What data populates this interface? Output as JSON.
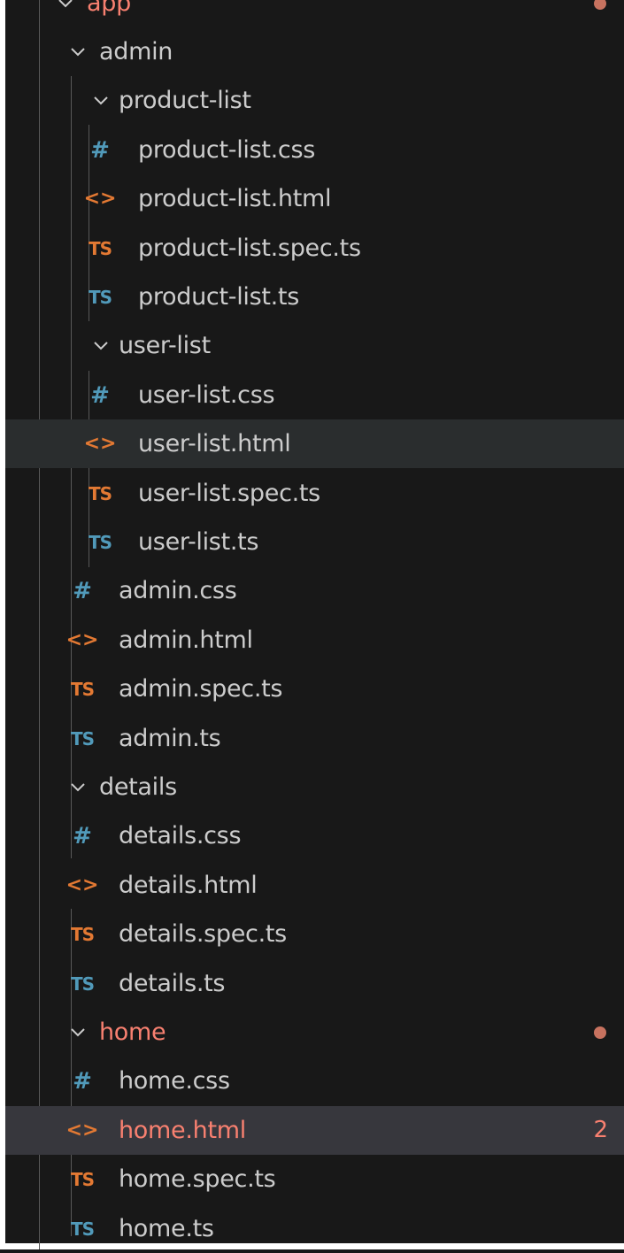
{
  "explorer": {
    "root": {
      "label": "app",
      "modified": true
    },
    "items": [
      {
        "kind": "folder",
        "label": "admin",
        "depth": 1
      },
      {
        "kind": "folder",
        "label": "product-list",
        "depth": 2
      },
      {
        "kind": "css",
        "label": "product-list.css",
        "depth": 3
      },
      {
        "kind": "html",
        "label": "product-list.html",
        "depth": 3
      },
      {
        "kind": "ts-spec",
        "label": "product-list.spec.ts",
        "depth": 3
      },
      {
        "kind": "ts",
        "label": "product-list.ts",
        "depth": 3
      },
      {
        "kind": "folder",
        "label": "user-list",
        "depth": 2
      },
      {
        "kind": "css",
        "label": "user-list.css",
        "depth": 3
      },
      {
        "kind": "html",
        "label": "user-list.html",
        "depth": 3,
        "state": "hover"
      },
      {
        "kind": "ts-spec",
        "label": "user-list.spec.ts",
        "depth": 3
      },
      {
        "kind": "ts",
        "label": "user-list.ts",
        "depth": 3
      },
      {
        "kind": "css",
        "label": "admin.css",
        "depth": 2
      },
      {
        "kind": "html",
        "label": "admin.html",
        "depth": 2
      },
      {
        "kind": "ts-spec",
        "label": "admin.spec.ts",
        "depth": 2
      },
      {
        "kind": "ts",
        "label": "admin.ts",
        "depth": 2
      },
      {
        "kind": "folder",
        "label": "details",
        "depth": 1
      },
      {
        "kind": "css",
        "label": "details.css",
        "depth": 2
      },
      {
        "kind": "html",
        "label": "details.html",
        "depth": 2
      },
      {
        "kind": "ts-spec",
        "label": "details.spec.ts",
        "depth": 2
      },
      {
        "kind": "ts",
        "label": "details.ts",
        "depth": 2
      },
      {
        "kind": "folder",
        "label": "home",
        "depth": 1,
        "modified": true
      },
      {
        "kind": "css",
        "label": "home.css",
        "depth": 2
      },
      {
        "kind": "html",
        "label": "home.html",
        "depth": 2,
        "state": "active",
        "modified": true,
        "problems": "2"
      },
      {
        "kind": "ts-spec",
        "label": "home.spec.ts",
        "depth": 2
      },
      {
        "kind": "ts",
        "label": "home.ts",
        "depth": 2
      }
    ]
  },
  "icons": {
    "folder": "chevron-down-icon",
    "css": "css-file-icon",
    "html": "html-file-icon",
    "ts-spec": "typescript-spec-file-icon",
    "ts": "typescript-file-icon"
  },
  "glyphs": {
    "css": "#",
    "html": "<>",
    "ts-spec": "TS",
    "ts": "TS"
  },
  "colors": {
    "background": "#181818",
    "text": "#cccccc",
    "modified": "#f88070",
    "css_icon": "#519aba",
    "ts_icon": "#519aba",
    "spec_icon": "#e37933",
    "html_icon": "#e37933",
    "active_row": "#37373d",
    "hover_row": "#2a2d2e"
  }
}
